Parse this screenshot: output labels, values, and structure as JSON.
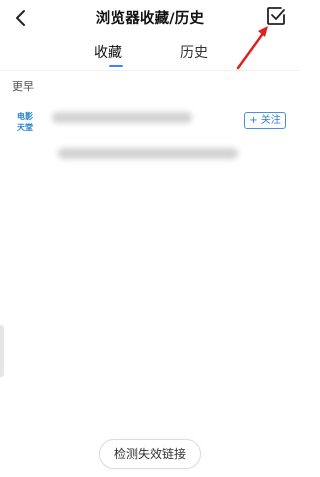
{
  "header": {
    "title": "浏览器收藏/历史",
    "back_icon": "chevron-left-icon",
    "edit_icon": "checkbox-edit-icon"
  },
  "tabs": [
    {
      "label": "收藏",
      "active": true
    },
    {
      "label": "历史",
      "active": false
    }
  ],
  "section": {
    "label": "更早"
  },
  "favorite_item": {
    "logo_text_line1": "电影",
    "logo_text_line2": "天堂",
    "follow_label": "+ 关注"
  },
  "footer": {
    "check_links_label": "检测失效链接"
  },
  "colors": {
    "accent": "#3a86ff",
    "annotation_arrow": "#e02020"
  }
}
